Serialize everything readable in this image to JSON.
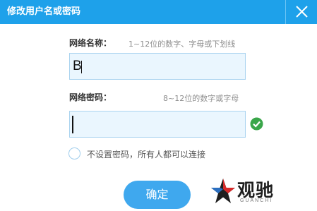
{
  "dialog": {
    "title": "修改用户名或密码"
  },
  "form": {
    "ssid_label": "网络名称：",
    "ssid_hint": "1~12位的数字、字母或下划线",
    "ssid_value": "B",
    "password_label": "网络密码：",
    "password_hint": "8~12位的数字或字母",
    "password_value": "",
    "no_password_label": "不设置密码，所有人都可以连接",
    "no_password_checked": false
  },
  "buttons": {
    "confirm_label": "确定"
  },
  "watermark": {
    "logo_text": "观驰",
    "logo_sub": "GUANCHI"
  },
  "colors": {
    "titlebar": "#1ea1ea",
    "button": "#3fa8ee",
    "valid": "#3aa64a"
  }
}
